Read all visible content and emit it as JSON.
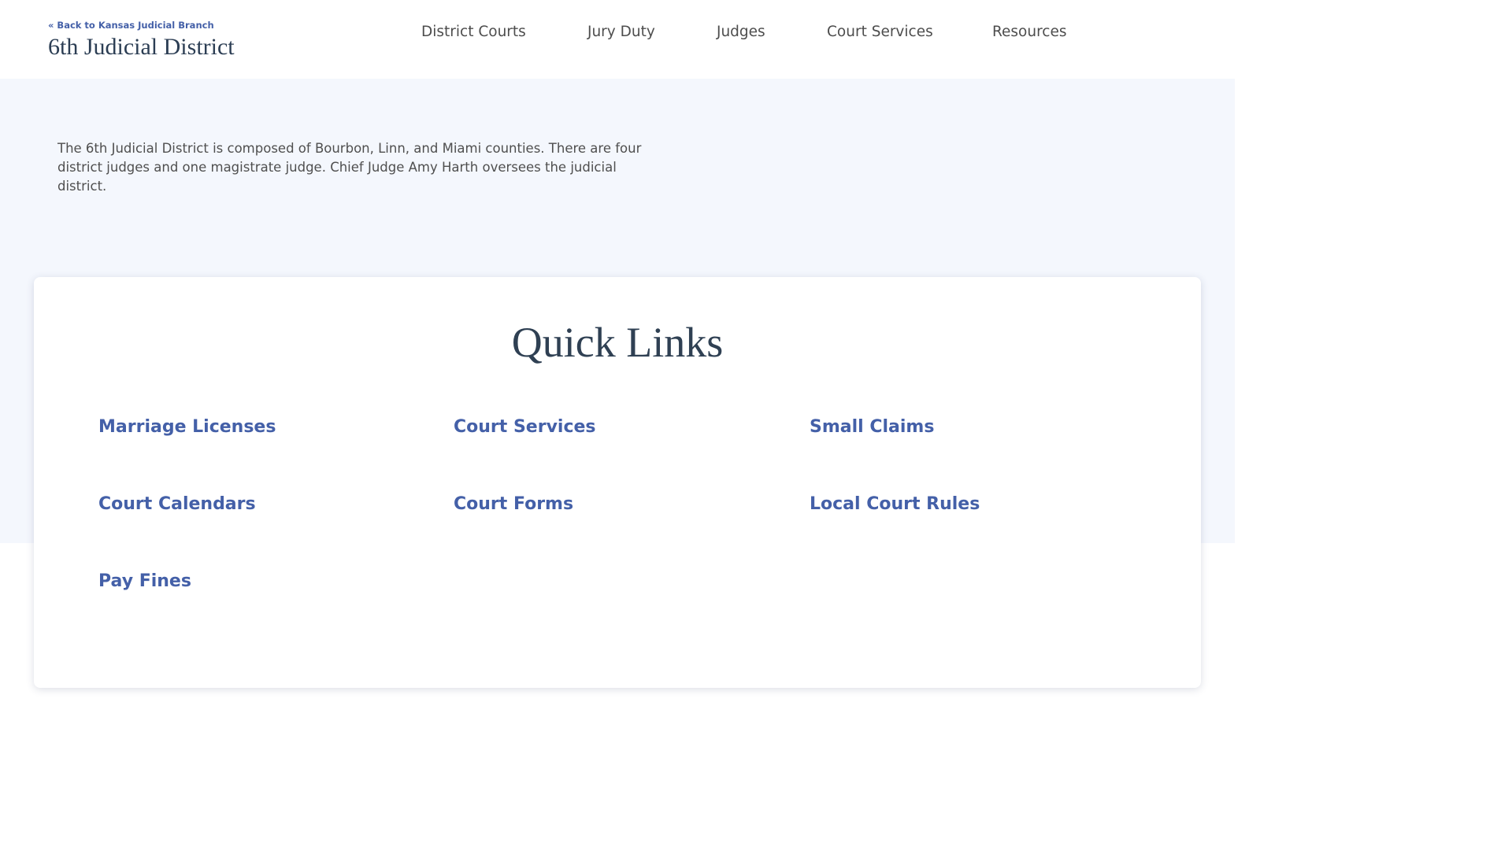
{
  "header": {
    "back_link": "« Back to Kansas Judicial Branch",
    "site_title": "6th Judicial District"
  },
  "nav": {
    "items": [
      "District Courts",
      "Jury Duty",
      "Judges",
      "Court Services",
      "Resources"
    ]
  },
  "intro": {
    "text": "The 6th Judicial District is composed of Bourbon, Linn, and Miami counties. There are four district judges and one magistrate judge. Chief Judge Amy Harth oversees the judicial district."
  },
  "quick_links": {
    "title": "Quick Links",
    "links": [
      "Marriage Licenses",
      "Court Services",
      "Small Claims",
      "Court Calendars",
      "Court Forms",
      "Local Court Rules",
      "Pay Fines"
    ]
  },
  "colors": {
    "link": "#4460a8",
    "heading": "#2c3e54",
    "hero_background": "#f4f7fd"
  }
}
